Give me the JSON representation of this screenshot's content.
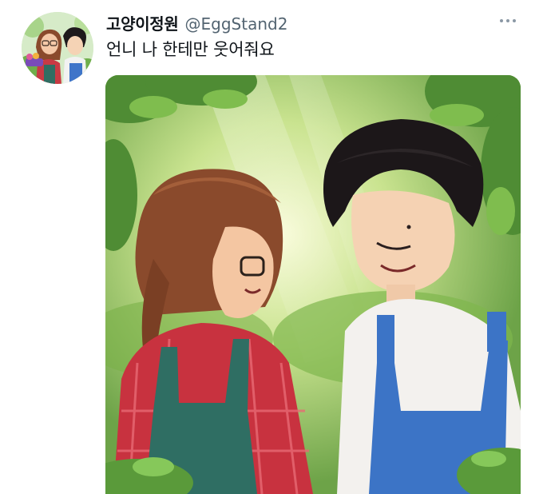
{
  "tweet": {
    "display_name": "고양이정원",
    "handle": "@EggStand2",
    "text": "언니 나 한테만 웃어줘요"
  },
  "icons": {
    "more": "more-horizontal-icon"
  },
  "colors": {
    "text_primary": "#0f1419",
    "text_secondary": "#536471",
    "icon_gray": "#8b98a5",
    "foliage_green": "#5f9a3c"
  }
}
